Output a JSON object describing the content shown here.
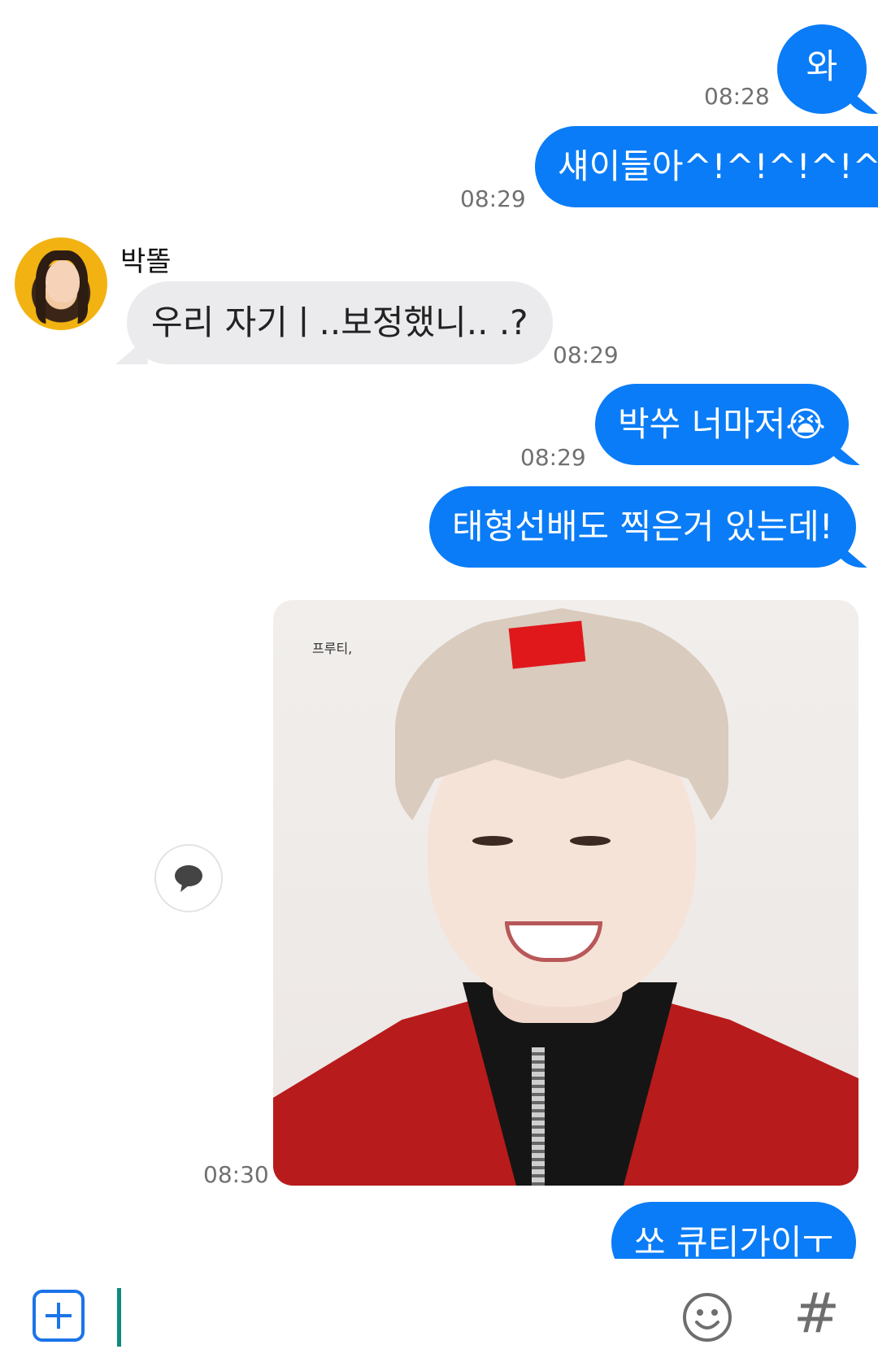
{
  "messages": {
    "m1": {
      "text": "와",
      "time": "08:28"
    },
    "m2": {
      "text": "섀이들아^!^!^!^!^!^!",
      "time": "08:29"
    },
    "m3": {
      "sender": "박똘",
      "text": "우리 자기ㅣ..보정했니.. .?",
      "time": "08:29"
    },
    "m4": {
      "text": "박쑤 너마저😭",
      "time": "08:29"
    },
    "m5": {
      "text": "태형선배도 찍은거 있는데!"
    },
    "m6": {
      "image_watermark": "프루티,",
      "time": "08:30"
    },
    "m7": {
      "text": "쏘 큐티가이ㅜ"
    }
  },
  "composer": {
    "attach_icon": "plus-square-icon",
    "emoji_icon": "smiley-icon",
    "hashtag_label": "#"
  },
  "colors": {
    "outgoing_bubble": "#0a7cf7",
    "incoming_bubble": "#ebebee",
    "accent": "#1b74e8",
    "cursor": "#0f8a7e"
  }
}
